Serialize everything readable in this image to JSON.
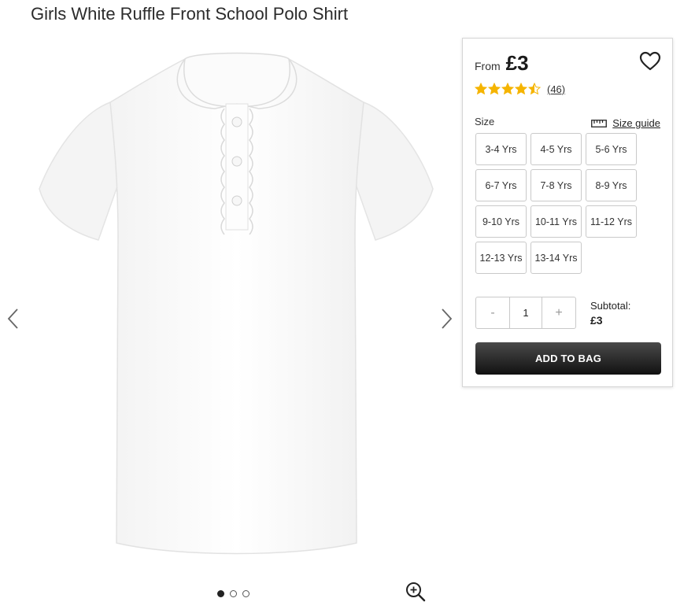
{
  "product": {
    "title": "Girls White Ruffle Front School Polo Shirt"
  },
  "gallery": {
    "prev_icon": "chevron-left-icon",
    "next_icon": "chevron-right-icon",
    "image_count": 3,
    "active_index": 0,
    "zoom_icon": "zoom-in-icon"
  },
  "panel": {
    "price_prefix": "From",
    "price": "£3",
    "wishlist_icon": "heart-icon",
    "rating": 4.5,
    "rating_max": 5,
    "review_count": "(46)",
    "star_color": "#f5b400",
    "size_label": "Size",
    "size_guide_label": "Size guide",
    "size_guide_icon": "ruler-icon",
    "sizes": [
      "3-4 Yrs",
      "4-5 Yrs",
      "5-6 Yrs",
      "6-7 Yrs",
      "7-8 Yrs",
      "8-9 Yrs",
      "9-10 Yrs",
      "10-11 Yrs",
      "11-12 Yrs",
      "12-13 Yrs",
      "13-14 Yrs"
    ],
    "quantity": {
      "minus": "-",
      "value": "1",
      "plus": "+"
    },
    "subtotal_label": "Subtotal:",
    "subtotal_value": "£3",
    "add_to_bag": "ADD TO BAG"
  }
}
